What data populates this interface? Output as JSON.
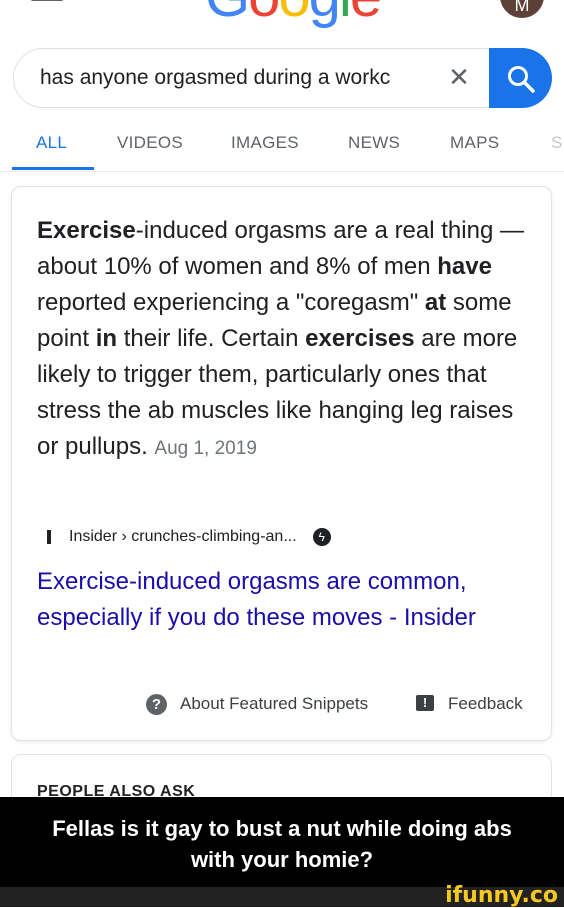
{
  "header": {
    "logo_letters": [
      {
        "ch": "G",
        "color": "#4285f4"
      },
      {
        "ch": "o",
        "color": "#ea4335"
      },
      {
        "ch": "o",
        "color": "#fbbc05"
      },
      {
        "ch": "g",
        "color": "#4285f4"
      },
      {
        "ch": "l",
        "color": "#34a853"
      },
      {
        "ch": "e",
        "color": "#ea4335"
      }
    ],
    "avatar_letter": "M",
    "menu_icon": "hamburger-icon"
  },
  "search": {
    "query": "has anyone orgasmed during a workc",
    "clear_symbol": "✕",
    "search_icon": "search-icon",
    "button_color": "#1a73e8"
  },
  "tabs": [
    {
      "label": "ALL",
      "active": true
    },
    {
      "label": "VIDEOS",
      "active": false
    },
    {
      "label": "IMAGES",
      "active": false
    },
    {
      "label": "NEWS",
      "active": false
    },
    {
      "label": "MAPS",
      "active": false
    },
    {
      "label": "S",
      "active": false
    }
  ],
  "featured_snippet": {
    "segments": [
      {
        "text": "Exercise",
        "bold": true
      },
      {
        "text": "-induced orgasms are a real thing — about 10% of women and 8% of men ",
        "bold": false
      },
      {
        "text": "have",
        "bold": true
      },
      {
        "text": " reported experiencing a \"coregasm\" ",
        "bold": false
      },
      {
        "text": "at",
        "bold": true
      },
      {
        "text": " some point ",
        "bold": false
      },
      {
        "text": "in",
        "bold": true
      },
      {
        "text": " their life. Certain ",
        "bold": false
      },
      {
        "text": "exercises",
        "bold": true
      },
      {
        "text": " are more likely to trigger them, particularly ones that stress the ab muscles like hanging leg raises or pullups.",
        "bold": false
      }
    ],
    "date": "Aug 1, 2019",
    "source_site": "Insider",
    "source_path": "› crunches-climbing-an...",
    "amp_symbol": "ϟ",
    "result_title": "Exercise-induced orgasms are common, especially if you do these moves - Insider",
    "link_color": "#1a0dab",
    "about_label": "About Featured Snippets",
    "help_symbol": "?",
    "feedback_label": "Feedback",
    "feedback_symbol": "!"
  },
  "people_also_ask": {
    "heading": "PEOPLE ALSO ASK"
  },
  "caption": {
    "line1": "Fellas is it gay to bust a nut while doing abs",
    "line2": "with your homie?"
  },
  "watermark": {
    "text": "ifunny.co",
    "color": "#f7c81d"
  }
}
